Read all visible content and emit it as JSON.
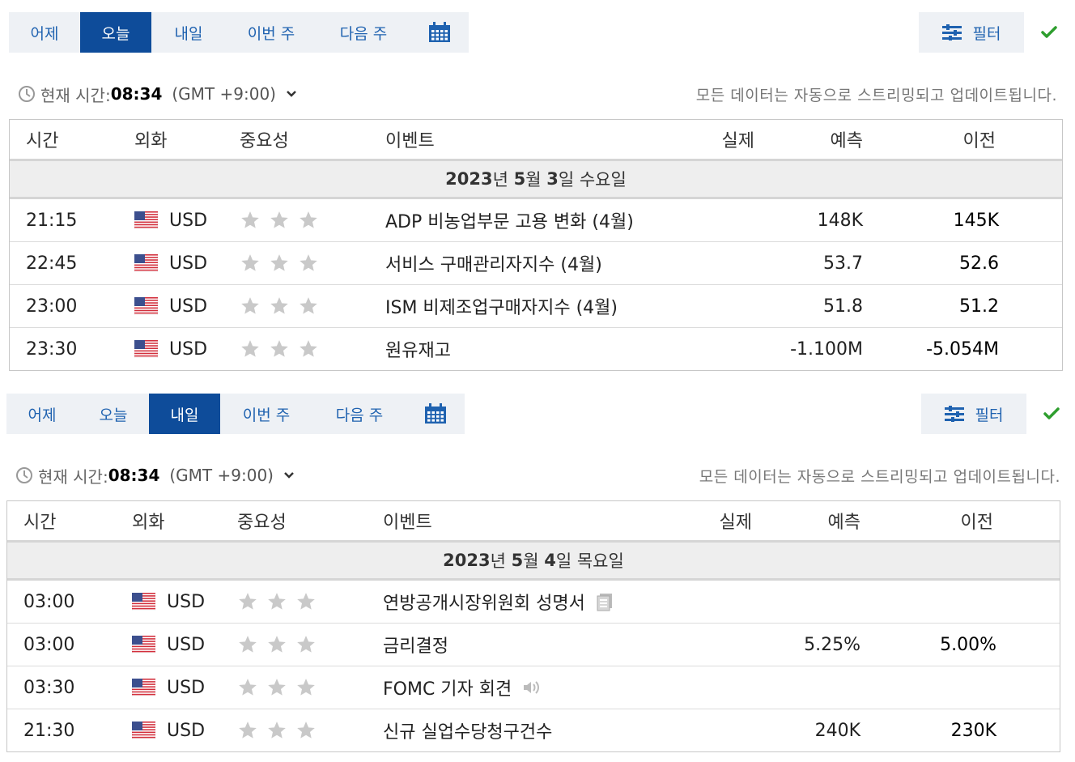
{
  "tabs": [
    "어제",
    "오늘",
    "내일",
    "이번 주",
    "다음 주"
  ],
  "filter_label": "필터",
  "time_label": "현재 시간:",
  "time_value": "08:34",
  "timezone": "(GMT +9:00)",
  "notice": "모든 데이터는 자동으로 스트리밍되고 업데이트됩니다.",
  "columns": {
    "time": "시간",
    "currency": "외화",
    "importance": "중요성",
    "event": "이벤트",
    "actual": "실제",
    "forecast": "예측",
    "previous": "이전"
  },
  "sections": [
    {
      "active_tab": "오늘",
      "date": {
        "year": "2023",
        "year_suffix": "년 ",
        "month": "5",
        "month_suffix": "월 ",
        "day": "3",
        "day_suffix": "일 수요일"
      },
      "events": [
        {
          "time": "21:15",
          "currency": "USD",
          "stars": 3,
          "event": "ADP 비농업부문 고용 변화 (4월)",
          "actual": "",
          "forecast": "148K",
          "previous": "145K",
          "icon": ""
        },
        {
          "time": "22:45",
          "currency": "USD",
          "stars": 3,
          "event": "서비스 구매관리자지수 (4월)",
          "actual": "",
          "forecast": "53.7",
          "previous": "52.6",
          "icon": ""
        },
        {
          "time": "23:00",
          "currency": "USD",
          "stars": 3,
          "event": "ISM 비제조업구매자지수 (4월)",
          "actual": "",
          "forecast": "51.8",
          "previous": "51.2",
          "icon": ""
        },
        {
          "time": "23:30",
          "currency": "USD",
          "stars": 3,
          "event": "원유재고",
          "actual": "",
          "forecast": "-1.100M",
          "previous": "-5.054M",
          "icon": ""
        }
      ]
    },
    {
      "active_tab": "내일",
      "date": {
        "year": "2023",
        "year_suffix": "년 ",
        "month": "5",
        "month_suffix": "월 ",
        "day": "4",
        "day_suffix": "일 목요일"
      },
      "events": [
        {
          "time": "03:00",
          "currency": "USD",
          "stars": 3,
          "event": "연방공개시장위원회 성명서",
          "actual": "",
          "forecast": "",
          "previous": "",
          "icon": "document-icon"
        },
        {
          "time": "03:00",
          "currency": "USD",
          "stars": 3,
          "event": "금리결정",
          "actual": "",
          "forecast": "5.25%",
          "previous": "5.00%",
          "icon": ""
        },
        {
          "time": "03:30",
          "currency": "USD",
          "stars": 3,
          "event": "FOMC 기자 회견",
          "actual": "",
          "forecast": "",
          "previous": "",
          "icon": "speaker-icon"
        },
        {
          "time": "21:30",
          "currency": "USD",
          "stars": 3,
          "event": "신규 실업수당청구건수",
          "actual": "",
          "forecast": "240K",
          "previous": "230K",
          "icon": ""
        }
      ]
    }
  ],
  "colors": {
    "accent": "#0e4c9a",
    "link": "#1f62b0",
    "check": "#2e9e2e",
    "star": "#c9c9c9"
  }
}
